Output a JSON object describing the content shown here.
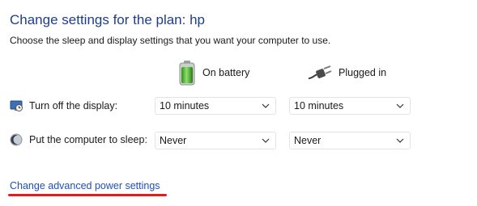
{
  "page": {
    "title": "Change settings for the plan: hp",
    "subtitle": "Choose the sleep and display settings that you want your computer to use."
  },
  "columns": {
    "battery": {
      "label": "On battery",
      "icon": "battery-icon"
    },
    "plugged": {
      "label": "Plugged in",
      "icon": "power-plug-icon"
    }
  },
  "rows": [
    {
      "label": "Turn off the display:",
      "icon": "display-timer-icon",
      "battery_value": "10 minutes",
      "plugged_value": "10 minutes"
    },
    {
      "label": "Put the computer to sleep:",
      "icon": "sleep-moon-icon",
      "battery_value": "Never",
      "plugged_value": "Never"
    }
  ],
  "links": {
    "advanced": "Change advanced power settings"
  },
  "colors": {
    "title": "#1e3d8f",
    "link": "#1e4fb8",
    "annotation": "#e31c1c"
  }
}
